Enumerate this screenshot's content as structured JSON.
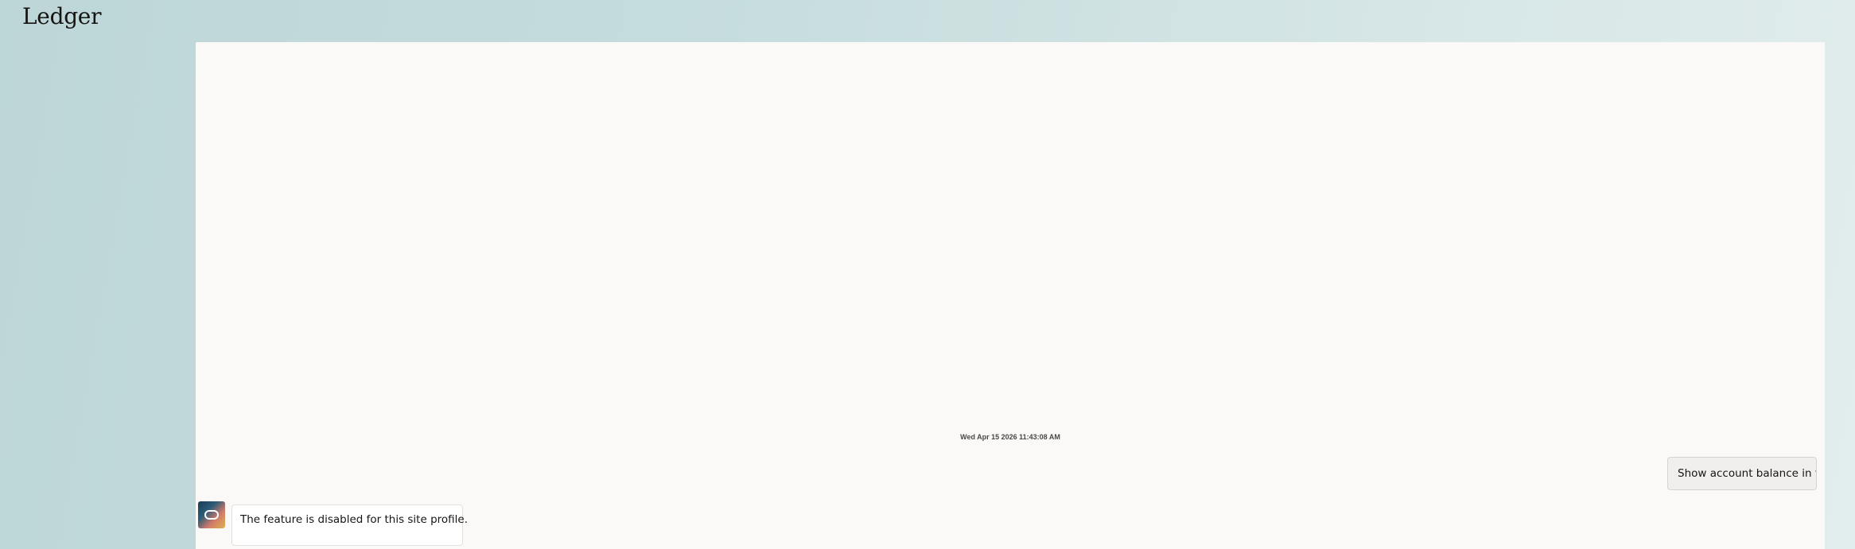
{
  "app": {
    "title": "Ledger"
  },
  "chat": {
    "timestamp": "Wed Apr 15 2026 11:43:08 AM",
    "messages": [
      {
        "role": "user",
        "text": "Show account balance in for"
      },
      {
        "role": "bot",
        "avatar_icon": "oracle-digital-assistant-icon",
        "text": "The feature is disabled for this site profile."
      }
    ]
  },
  "colors": {
    "background_start": "#bdd6d8",
    "background_end": "#e2eded",
    "panel": "#faf9f7",
    "user_bubble": "#f1efed",
    "bot_bubble": "#ffffff",
    "text": "#161513"
  }
}
